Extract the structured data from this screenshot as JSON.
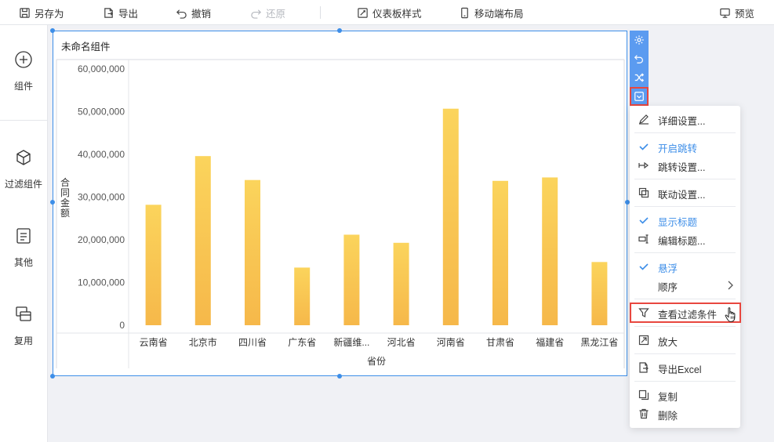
{
  "toolbar": {
    "save_as": "另存为",
    "export": "导出",
    "undo": "撤销",
    "redo": "还原",
    "dashboard_style": "仪表板样式",
    "mobile_layout": "移动端布局",
    "preview": "预览"
  },
  "sidebar": {
    "items": [
      {
        "label": "组件",
        "icon": "plus-circle-icon"
      },
      {
        "label": "过滤组件",
        "icon": "cube-icon"
      },
      {
        "label": "其他",
        "icon": "document-icon"
      },
      {
        "label": "复用",
        "icon": "layers-icon"
      }
    ]
  },
  "widget": {
    "title": "未命名组件"
  },
  "chart_data": {
    "type": "bar",
    "title": "",
    "xlabel": "省份",
    "ylabel": "合同金额",
    "ylim": [
      0,
      60000000
    ],
    "yticks": [
      "0",
      "10,000,000",
      "20,000,000",
      "30,000,000",
      "40,000,000",
      "50,000,000",
      "60,000,000"
    ],
    "categories": [
      "云南省",
      "北京市",
      "四川省",
      "广东省",
      "新疆维...",
      "河北省",
      "河南省",
      "甘肃省",
      "福建省",
      "黑龙江省"
    ],
    "values": [
      28200000,
      39600000,
      34000000,
      13500000,
      21200000,
      19300000,
      50700000,
      33800000,
      34600000,
      14800000
    ],
    "colors": {
      "bar_top": "#fbd45c",
      "bar_bottom": "#f6b84a"
    },
    "grid": false,
    "legend": "none"
  },
  "widget_tools": [
    {
      "icon": "gear-icon"
    },
    {
      "icon": "undo-icon"
    },
    {
      "icon": "shuffle-icon"
    },
    {
      "icon": "dropdown-menu-icon"
    }
  ],
  "menu": {
    "detail_settings": "详细设置...",
    "enable_jump": "开启跳转",
    "jump_settings": "跳转设置...",
    "linkage_settings": "联动设置...",
    "show_title": "显示标题",
    "edit_title": "编辑标题...",
    "hover": "悬浮",
    "order": "顺序",
    "view_filter": "查看过滤条件",
    "zoom": "放大",
    "export_excel": "导出Excel",
    "copy": "复制",
    "delete": "删除"
  },
  "colors": {
    "accent": "#3d8ee8",
    "highlight": "#e8473f",
    "tool_bg": "#5b9bf0"
  }
}
